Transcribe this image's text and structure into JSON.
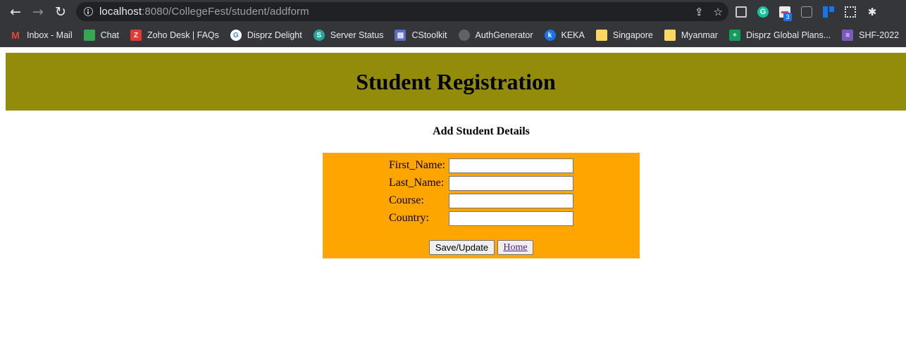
{
  "browser": {
    "url_host": "localhost",
    "url_rest": ":8080/CollegeFest/student/addform",
    "extensions": [
      "cast-icon",
      "grammarly-icon",
      "extension-badge-icon",
      "screen-capture-icon",
      "trello-icon",
      "qr-code-icon",
      "puzzle-icon"
    ],
    "extension_badge_count": "3",
    "bookmarks": [
      {
        "label": "Inbox - Mail",
        "icon": "gmail-icon",
        "color": "#ea4335",
        "glyph": "M"
      },
      {
        "label": "Chat",
        "icon": "google-chat-icon",
        "color": "#34a853",
        "glyph": ""
      },
      {
        "label": "Zoho Desk | FAQs",
        "icon": "zoho-icon",
        "color": "#e53935",
        "glyph": "Z"
      },
      {
        "label": "Disprz Delight",
        "icon": "google-icon",
        "color": "#ffffff",
        "glyph": "G"
      },
      {
        "label": "Server Status",
        "icon": "server-status-icon",
        "color": "#26a69a",
        "glyph": "S"
      },
      {
        "label": "CStoolkit",
        "icon": "cstoolkit-icon",
        "color": "#5c6bc0",
        "glyph": "▤"
      },
      {
        "label": "AuthGenerator",
        "icon": "globe-icon",
        "color": "#5f6368",
        "glyph": ""
      },
      {
        "label": "KEKA",
        "icon": "keka-icon",
        "color": "#1a73e8",
        "glyph": "k"
      },
      {
        "label": "Singapore",
        "icon": "folder-icon",
        "color": "#fdd663",
        "glyph": ""
      },
      {
        "label": "Myanmar",
        "icon": "folder-icon",
        "color": "#fdd663",
        "glyph": ""
      },
      {
        "label": "Disprz Global Plans...",
        "icon": "sheets-icon",
        "color": "#0f9d58",
        "glyph": "+"
      },
      {
        "label": "SHF-2022",
        "icon": "forms-icon",
        "color": "#7e57c2",
        "glyph": "≡"
      }
    ]
  },
  "page": {
    "title": "Student Registration",
    "subheading": "Add Student Details",
    "form": {
      "fields": [
        {
          "label": "First_Name:",
          "value": ""
        },
        {
          "label": "Last_Name:",
          "value": ""
        },
        {
          "label": "Course:",
          "value": ""
        },
        {
          "label": "Country:",
          "value": ""
        }
      ],
      "save_label": "Save/Update",
      "home_label": "Home"
    },
    "colors": {
      "header_band": "#938b0a",
      "form_background": "#ffa500"
    }
  }
}
